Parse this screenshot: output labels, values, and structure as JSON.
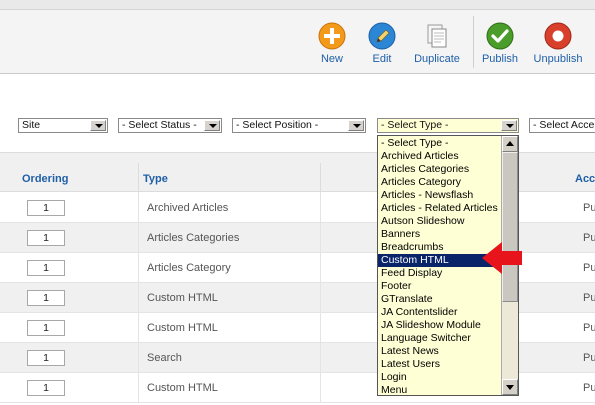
{
  "toolbar": {
    "buttons": [
      {
        "label": "New",
        "icon": "plus-icon",
        "color": "#f39a1a"
      },
      {
        "label": "Edit",
        "icon": "pencil-icon",
        "color": "#2b86d6"
      },
      {
        "label": "Duplicate",
        "icon": "copy-icon",
        "color": "#cfcfcf"
      },
      {
        "label": "Publish",
        "icon": "check-icon",
        "color": "#4a9d2a"
      },
      {
        "label": "Unpublish",
        "icon": "stop-icon",
        "color": "#d9402b"
      }
    ]
  },
  "filters": {
    "site": "Site",
    "status": "- Select Status -",
    "position": "- Select Position -",
    "type": "- Select Type -",
    "access": "- Select Acce"
  },
  "table": {
    "headers": {
      "ordering": "Ordering",
      "type": "Type",
      "access": "Acc"
    },
    "rows": [
      {
        "ordering": "1",
        "type": "Archived Articles",
        "access": "Pu"
      },
      {
        "ordering": "1",
        "type": "Articles Categories",
        "access": "Pu"
      },
      {
        "ordering": "1",
        "type": "Articles Category",
        "access": "Pu"
      },
      {
        "ordering": "1",
        "type": "Custom HTML",
        "access": "Pu"
      },
      {
        "ordering": "1",
        "type": "Custom HTML",
        "access": "Pu"
      },
      {
        "ordering": "1",
        "type": "Search",
        "access": "Pu"
      },
      {
        "ordering": "1",
        "type": "Custom HTML",
        "access": "Pu"
      }
    ]
  },
  "type_dropdown": {
    "selected_index": 9,
    "options": [
      "- Select Type -",
      "Archived Articles",
      "Articles Categories",
      "Articles Category",
      "Articles - Newsflash",
      "Articles - Related Articles",
      "Autson Slideshow",
      "Banners",
      "Breadcrumbs",
      "Custom HTML",
      "Feed Display",
      "Footer",
      "GTranslate",
      "JA Contentslider",
      "JA Slideshow Module",
      "Language Switcher",
      "Latest News",
      "Latest Users",
      "Login",
      "Menu"
    ]
  },
  "colors": {
    "link": "#1f5fa8",
    "highlight": "#0a246a",
    "dropdown_bg": "#ffffd5",
    "arrow": "#e8141b"
  }
}
